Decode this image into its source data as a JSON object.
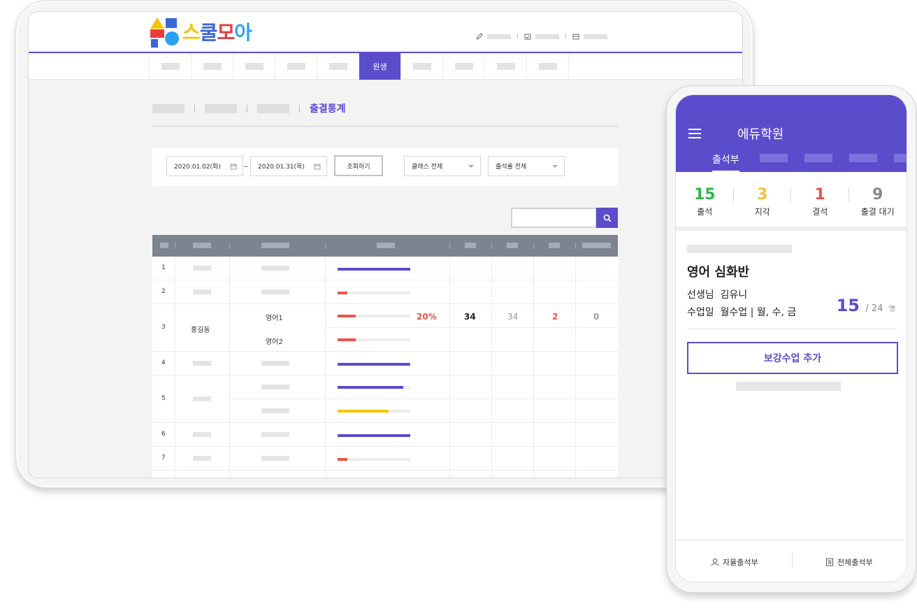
{
  "tablet": {
    "logo": {
      "part1": "스",
      "part2": "쿨",
      "part3": "모",
      "part4": "아"
    },
    "nav": {
      "active_label": "원생"
    },
    "breadcrumb": {
      "current": "출결통계"
    },
    "filter": {
      "date_from": "2020.01.02(화)",
      "tilde": "~",
      "date_to": "2020.01.31(목)",
      "query_button": "조회하기",
      "class_select": "클래스 전체",
      "rate_select": "출석률 전체"
    },
    "table": {
      "rows": [
        {
          "no": "1",
          "progress": 1.0,
          "color": "#5b4ccc"
        },
        {
          "no": "2",
          "progress": 0.13,
          "color": "#e8554a"
        },
        {
          "no": "3",
          "name": "홍길동",
          "class_a": "영어1",
          "class_b": "영어2",
          "progress_a": 0.25,
          "progress_b": 0.25,
          "color": "#e8554a",
          "rate": "20%",
          "total": "34",
          "present": "34",
          "late": "2",
          "absent": "0"
        },
        {
          "no": "4",
          "progress": 1.0,
          "color": "#5b4ccc"
        },
        {
          "no": "5",
          "progress_a": 0.9,
          "progress_b": 0.7,
          "color_a": "#5b4ccc",
          "color_b": "#f5c400"
        },
        {
          "no": "6",
          "progress": 1.0,
          "color": "#5b4ccc"
        },
        {
          "no": "7",
          "progress": 0.13,
          "color": "#e8554a"
        }
      ]
    }
  },
  "phone": {
    "title": "에듀학원",
    "tab": "출석부",
    "stats": [
      {
        "num": "15",
        "label": "출석",
        "color": "#2fb84b"
      },
      {
        "num": "3",
        "label": "지각",
        "color": "#f5c033"
      },
      {
        "num": "1",
        "label": "결석",
        "color": "#e8554a"
      },
      {
        "num": "9",
        "label": "출결 대기",
        "color": "#888888"
      }
    ],
    "class_name": "영어 심화반",
    "teacher_label": "선생님",
    "teacher_name": "김유니",
    "day_label": "수업일",
    "day_value": "월수업 | 월, 수, 금",
    "count": "15",
    "total": "/ 24",
    "unit": "명",
    "add_button": "보강수업 추가",
    "footer_left": "자율출석부",
    "footer_right": "전체출석부"
  }
}
